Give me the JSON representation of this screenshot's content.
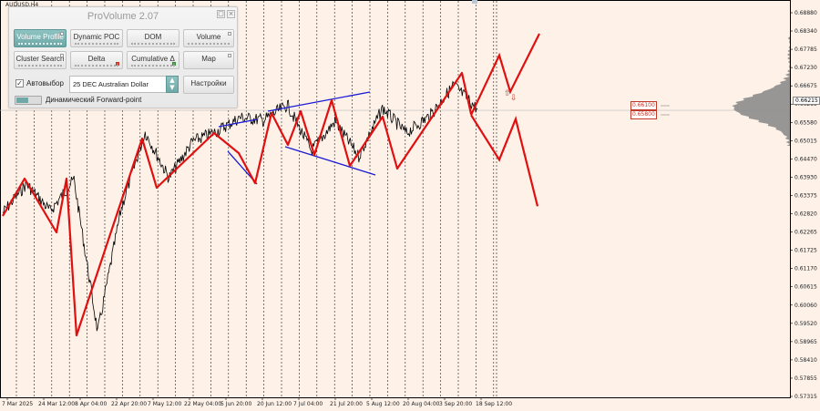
{
  "symbol_label": "AUDUSD,H4",
  "panel": {
    "title": "ProVolume 2.07",
    "controls": [
      "▢",
      "×"
    ],
    "buttons_row1": [
      "Volume Profile",
      "Dynamic POC",
      "DOM",
      "Volume"
    ],
    "buttons_row2": [
      "Cluster Search",
      "Delta",
      "Cumulative Δ",
      "Map"
    ],
    "auto_check": "✓",
    "auto_label": "Автовыбор",
    "instrument_value": "25 DEC Australian Dollar",
    "settings_label": "Настройки",
    "forward_label": "Динамический Forward-point",
    "active_button": "Volume Profile"
  },
  "price_axis": {
    "labels": [
      "0.68880",
      "0.68340",
      "0.67785",
      "0.67230",
      "0.66675",
      "0.66215",
      "0.65580",
      "0.65015",
      "0.64470",
      "0.63930",
      "0.63375",
      "0.62820",
      "0.62265",
      "0.61725",
      "0.61170",
      "0.60615",
      "0.60060",
      "0.59520",
      "0.58965",
      "0.58410",
      "0.57855",
      "0.57315"
    ],
    "current_price": "0.66215"
  },
  "time_axis": {
    "labels": [
      "7 Mar 2025",
      "24 Mar 12:00",
      "8 Apr 04:00",
      "22 Apr 20:00",
      "7 May 12:00",
      "22 May 04:00",
      "5 Jun 20:00",
      "20 Jun 12:00",
      "7 Jul 04:00",
      "21 Jul 20:00",
      "5 Aug 12:00",
      "20 Aug 04:00",
      "3 Sep 20:00",
      "18 Sep 12:00"
    ]
  },
  "price_tags": {
    "upper": "0.66100",
    "lower": "0.65800"
  },
  "colors": {
    "background": "#fdf1e8",
    "price_series": "#000000",
    "pattern_line": "#e01010",
    "channel_line": "#1a1ad6",
    "profile": "#8c8c8c",
    "accent": "#6fa8a7"
  },
  "chart_data": {
    "type": "line",
    "x": [
      "7 Mar 2025",
      "24 Mar 12:00",
      "8 Apr 04:00",
      "22 Apr 20:00",
      "7 May 12:00",
      "22 May 04:00",
      "5 Jun 20:00",
      "20 Jun 12:00",
      "7 Jul 04:00",
      "21 Jul 20:00",
      "5 Aug 12:00",
      "20 Aug 04:00",
      "3 Sep 20:00",
      "18 Sep 12:00"
    ],
    "ylim": [
      0.57315,
      0.6888
    ],
    "grid": true,
    "series": [
      {
        "values": [
          0.6285,
          0.6372,
          0.629,
          0.6385,
          0.5925,
          0.63,
          0.6528,
          0.639,
          0.65,
          0.653,
          0.6572,
          0.6565,
          0.661,
          0.6472,
          0.656,
          0.6455,
          0.66,
          0.6525,
          0.6578,
          0.667,
          0.6598
        ]
      }
    ],
    "zigzag": [
      [
        0.632,
        0.6385,
        0.6265,
        0.6375,
        0.592,
        0.652,
        0.638,
        0.6455,
        0.6545,
        0.6545,
        0.648,
        0.6575,
        0.65,
        0.655,
        0.658,
        0.6605,
        0.65,
        0.66,
        0.65,
        0.6605,
        0.644,
        0.6585,
        0.6455,
        0.667,
        0.661
      ],
      [
        0.661,
        0.679,
        0.668,
        0.6855
      ],
      [
        0.661,
        0.6475,
        0.6598,
        0.6335
      ]
    ],
    "profile_peak": 0.6625
  }
}
